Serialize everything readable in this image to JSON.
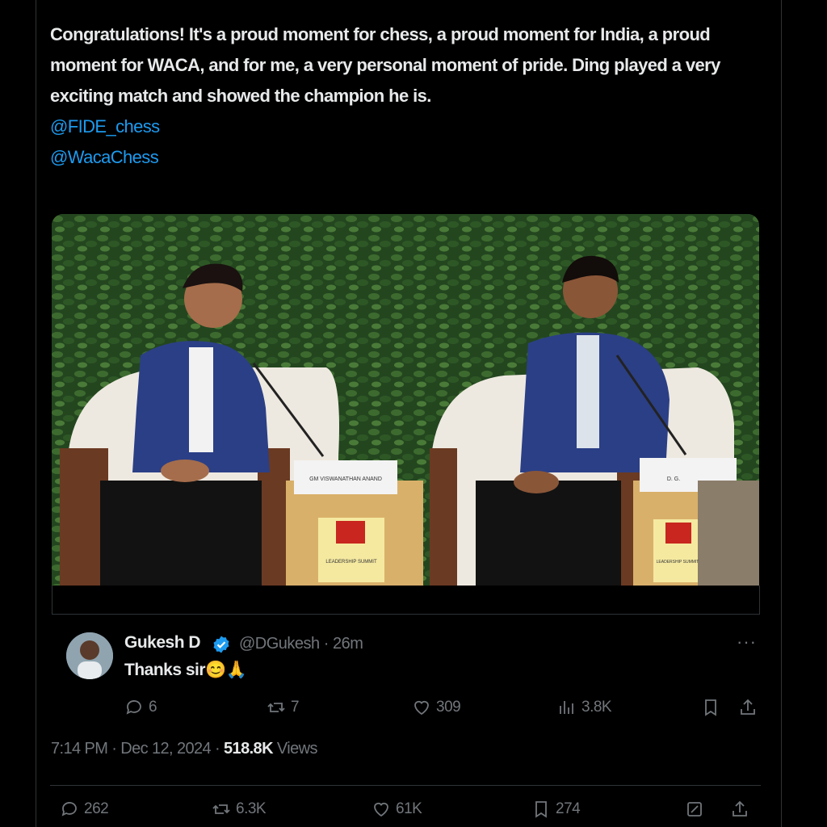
{
  "tweet": {
    "text": "Congratulations! It's a proud moment for chess, a proud moment for India, a proud moment for WACA, and for me, a very personal moment of pride. Ding played a very exciting match and showed the champion he is.",
    "mentions": [
      "@FIDE_chess",
      "@WacaChess"
    ],
    "photo": {
      "left_nameplate": "GM VISWANATHAN ANAND",
      "right_nameplate": "D. G.",
      "left_sign": "LEADERSHIP SUMMIT",
      "right_sign": "LEADERSHIP SUMMIT"
    },
    "timestamp": "7:14 PM · Dec 12, 2024 ·",
    "views_count": "518.8K",
    "views_label": "Views",
    "actions": {
      "replies": "262",
      "reposts": "6.3K",
      "likes": "61K",
      "bookmarks": "274"
    }
  },
  "reply": {
    "name": "Gukesh D",
    "handle_time": "@DGukesh · 26m",
    "more": "···",
    "text": "Thanks sir😊🙏",
    "actions": {
      "replies": "6",
      "reposts": "7",
      "likes": "309",
      "views": "3.8K"
    }
  },
  "colors": {
    "background": "#000000",
    "text": "#e7e9ea",
    "muted": "#71767b",
    "link": "#1d9bf0",
    "border": "#2f3336"
  },
  "icons": [
    "reply-icon",
    "repost-icon",
    "like-icon",
    "views-icon",
    "bookmark-icon",
    "share-icon",
    "grok-icon",
    "verified-badge-icon",
    "more-icon"
  ]
}
